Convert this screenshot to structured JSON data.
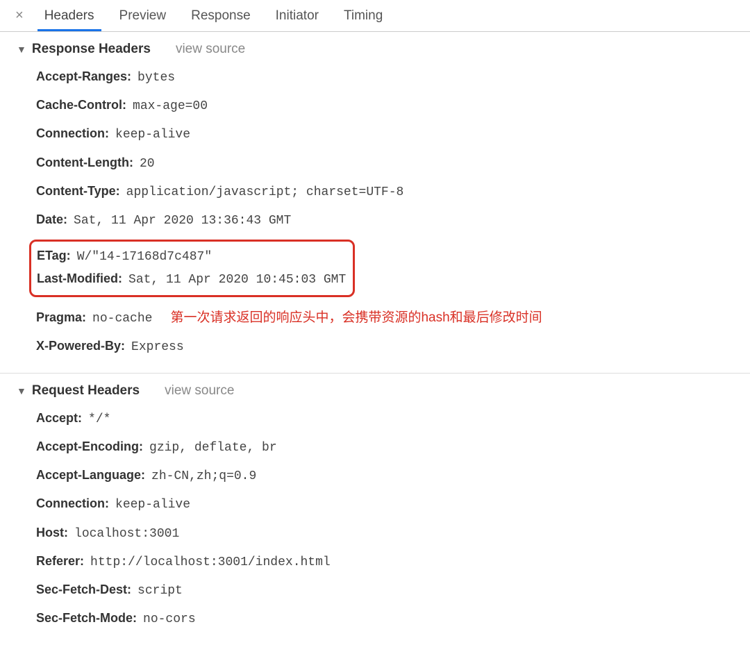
{
  "tabs": {
    "headers": "Headers",
    "preview": "Preview",
    "response": "Response",
    "initiator": "Initiator",
    "timing": "Timing"
  },
  "response_headers": {
    "title": "Response Headers",
    "view_source": "view source",
    "items": [
      {
        "name": "Accept-Ranges:",
        "value": "bytes"
      },
      {
        "name": "Cache-Control:",
        "value": "max-age=00"
      },
      {
        "name": "Connection:",
        "value": "keep-alive"
      },
      {
        "name": "Content-Length:",
        "value": "20"
      },
      {
        "name": "Content-Type:",
        "value": "application/javascript; charset=UTF-8"
      },
      {
        "name": "Date:",
        "value": "Sat, 11 Apr 2020 13:36:43 GMT"
      }
    ],
    "highlighted": [
      {
        "name": "ETag:",
        "value": "W/\"14-17168d7c487\""
      },
      {
        "name": "Last-Modified:",
        "value": "Sat, 11 Apr 2020 10:45:03 GMT"
      }
    ],
    "after_highlight": [
      {
        "name": "Pragma:",
        "value": "no-cache"
      },
      {
        "name": "X-Powered-By:",
        "value": "Express"
      }
    ],
    "annotation": "第一次请求返回的响应头中，会携带资源的hash和最后修改时间"
  },
  "request_headers": {
    "title": "Request Headers",
    "view_source": "view source",
    "items": [
      {
        "name": "Accept:",
        "value": "*/*"
      },
      {
        "name": "Accept-Encoding:",
        "value": "gzip, deflate, br"
      },
      {
        "name": "Accept-Language:",
        "value": "zh-CN,zh;q=0.9"
      },
      {
        "name": "Connection:",
        "value": "keep-alive"
      },
      {
        "name": "Host:",
        "value": "localhost:3001"
      },
      {
        "name": "Referer:",
        "value": "http://localhost:3001/index.html"
      },
      {
        "name": "Sec-Fetch-Dest:",
        "value": "script"
      },
      {
        "name": "Sec-Fetch-Mode:",
        "value": "no-cors"
      }
    ]
  }
}
